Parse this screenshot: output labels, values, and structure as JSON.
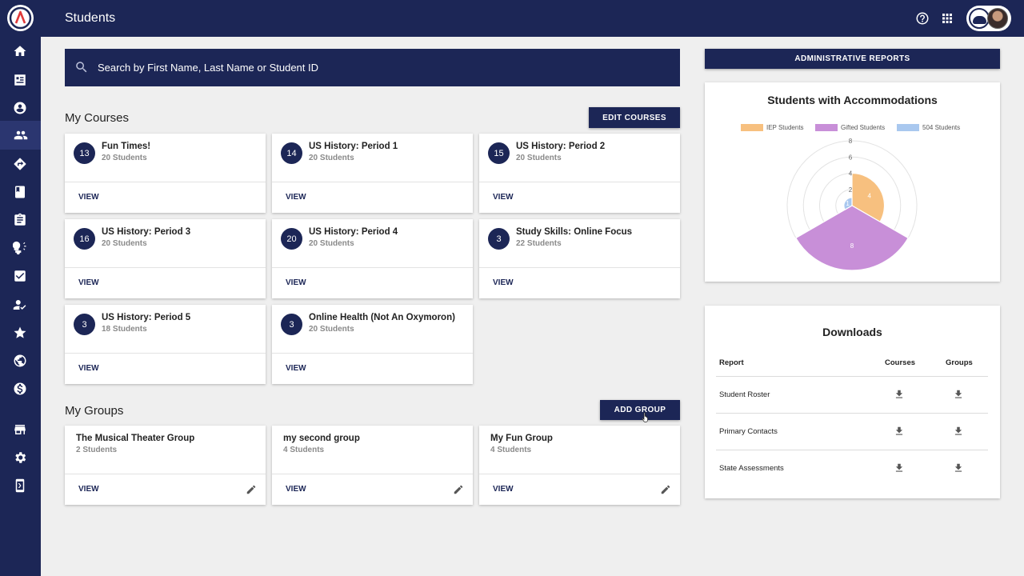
{
  "header": {
    "title": "Students"
  },
  "search": {
    "placeholder": "Search by First Name, Last Name or Student ID"
  },
  "sidebar": {
    "icons": [
      "home-icon",
      "dashboard-icon",
      "account-icon",
      "students-icon",
      "directions-icon",
      "book-icon",
      "assignment-icon",
      "lightbulb-icon",
      "checklist-icon",
      "user-check-icon",
      "star-icon",
      "globe-icon",
      "dollar-icon",
      "store-icon",
      "settings-icon",
      "tablet-icon"
    ],
    "active": "students-icon"
  },
  "courses": {
    "title": "My Courses",
    "edit_label": "EDIT COURSES",
    "view_label": "VIEW",
    "items": [
      {
        "count": "13",
        "name": "Fun Times!",
        "students": "20 Students"
      },
      {
        "count": "14",
        "name": "US History: Period 1",
        "students": "20 Students"
      },
      {
        "count": "15",
        "name": "US History: Period 2",
        "students": "20 Students"
      },
      {
        "count": "16",
        "name": "US History: Period 3",
        "students": "20 Students"
      },
      {
        "count": "20",
        "name": "US History: Period 4",
        "students": "20 Students"
      },
      {
        "count": "3",
        "name": "Study Skills: Online Focus",
        "students": "22 Students"
      },
      {
        "count": "3",
        "name": "US History: Period 5",
        "students": "18 Students"
      },
      {
        "count": "3",
        "name": "Online Health (Not An Oxymoron)",
        "students": "20 Students"
      }
    ]
  },
  "groups": {
    "title": "My Groups",
    "add_label": "ADD GROUP",
    "view_label": "VIEW",
    "items": [
      {
        "name": "The Musical Theater Group",
        "students": "2 Students"
      },
      {
        "name": "my second group",
        "students": "4 Students"
      },
      {
        "name": "My Fun Group",
        "students": "4 Students"
      }
    ]
  },
  "admin_reports_label": "ADMINISTRATIVE REPORTS",
  "accommodations": {
    "title": "Students with Accommodations",
    "legend": [
      "IEP Students",
      "Gifted Students",
      "504 Students"
    ],
    "colors": {
      "iep": "#f7c07f",
      "gifted": "#c88fd8",
      "s504": "#a9c8ef"
    }
  },
  "chart_data": {
    "type": "polarArea",
    "title": "Students with Accommodations",
    "categories": [
      "IEP Students",
      "Gifted Students",
      "504 Students"
    ],
    "values": [
      4,
      8,
      1
    ],
    "value_labels": [
      "4",
      "8",
      "1"
    ],
    "rlim": [
      0,
      8
    ],
    "ticks": [
      "8",
      "6",
      "4",
      "2"
    ],
    "legend_position": "top"
  },
  "downloads": {
    "title": "Downloads",
    "col_report": "Report",
    "col_courses": "Courses",
    "col_groups": "Groups",
    "rows": [
      "Student Roster",
      "Primary Contacts",
      "State Assessments"
    ]
  }
}
